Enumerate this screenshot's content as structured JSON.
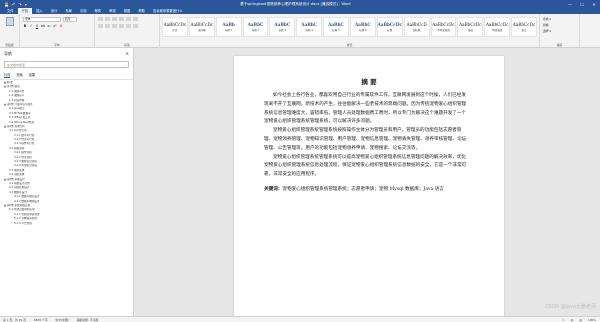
{
  "window": {
    "title": "基于springboot宠物领养心理护理系统设计.docx [兼容模式] - Word",
    "quick_access": [
      "💾",
      "↶",
      "↷",
      "▾"
    ],
    "controls": [
      "—",
      "☐",
      "✕"
    ]
  },
  "tabs": [
    "文件",
    "开始",
    "插入",
    "设计",
    "布局",
    "引用",
    "邮件",
    "审阅",
    "视图",
    "帮助",
    "告诉我你想要做什么"
  ],
  "ribbon": {
    "clipboard_label": "剪贴板",
    "font_label": "字体",
    "font_name": "宋体",
    "font_size": "四号",
    "format_buttons": [
      "B",
      "I",
      "U",
      "ab",
      "x₂",
      "x²",
      "A"
    ],
    "paragraph_label": "段落",
    "styles_label": "样式",
    "styles": [
      {
        "sample": "AaBbCcDc",
        "name": "正文",
        "head": false
      },
      {
        "sample": "AaBbCcDc",
        "name": "无间隔",
        "head": false
      },
      {
        "sample": "AaBb",
        "name": "标题 1",
        "head": true
      },
      {
        "sample": "AaBbC",
        "name": "标题 2",
        "head": true
      },
      {
        "sample": "AaBbC",
        "name": "标题 3",
        "head": true
      },
      {
        "sample": "AaBbC",
        "name": "标题 4",
        "head": true
      },
      {
        "sample": "AaBbC",
        "name": "标题 5",
        "head": true
      },
      {
        "sample": "AaBbC",
        "name": "标题 6",
        "head": true
      },
      {
        "sample": "AaBbCcDc",
        "name": "标题",
        "head": true
      },
      {
        "sample": "AaBbCcD",
        "name": "副标题",
        "head": false
      },
      {
        "sample": "AaBbCcDc",
        "name": "不明显强调",
        "head": false
      },
      {
        "sample": "AaBbCcDc",
        "name": "强调",
        "head": false
      },
      {
        "sample": "AaBbCcDc",
        "name": "明显强调",
        "head": false
      },
      {
        "sample": "AaBbCcDc",
        "name": "要点",
        "head": false
      }
    ],
    "editing_label": "编辑",
    "editing_items": [
      "查找 ▾",
      "替换",
      "选择 ▾"
    ]
  },
  "nav": {
    "title": "导航",
    "close": "✕",
    "search_placeholder": "在文档中搜索",
    "tabs": [
      "标题",
      "页面",
      "结果"
    ],
    "outline": [
      {
        "level": 1,
        "text": "▲ 摘 要"
      },
      {
        "level": 1,
        "text": "▲ 第1章 绪论"
      },
      {
        "level": 2,
        "text": "1.1 课题背景"
      },
      {
        "level": 2,
        "text": "1.2 课题意义"
      },
      {
        "level": 2,
        "text": "1.3 研究内容"
      },
      {
        "level": 1,
        "text": "▲ 第2章 开发环境与技术"
      },
      {
        "level": 2,
        "text": "2.1 Java语言"
      },
      {
        "level": 2,
        "text": "2.2 MYSQL数据库"
      },
      {
        "level": 2,
        "text": "2.3 IDEA开发工具"
      },
      {
        "level": 2,
        "text": "2.4 Spring Boot框架"
      },
      {
        "level": 1,
        "text": "▲ 第3章 需求分析"
      },
      {
        "level": 2,
        "text": "3.1 可行性分析"
      },
      {
        "level": 3,
        "text": "3.1.1 技术可行性"
      },
      {
        "level": 3,
        "text": "3.1.2 经济可行性"
      },
      {
        "level": 3,
        "text": "3.1.3 操作可行性"
      },
      {
        "level": 2,
        "text": "3.2 系统流程"
      },
      {
        "level": 3,
        "text": "3.2.1 操作流程"
      },
      {
        "level": 3,
        "text": "3.2.2 登录流程"
      },
      {
        "level": 3,
        "text": "3.2.3 删除信息流程"
      },
      {
        "level": 3,
        "text": "3.2.4 添加信息流程"
      },
      {
        "level": 2,
        "text": "3.3 性能需求"
      },
      {
        "level": 2,
        "text": "3.4 功能需求"
      },
      {
        "level": 1,
        "text": "▲ 第4章 系统设计"
      },
      {
        "level": 2,
        "text": "4.1 系统设计思想"
      },
      {
        "level": 2,
        "text": "4.2 功能结构设计"
      },
      {
        "level": 2,
        "text": "4.3 数据库设计"
      },
      {
        "level": 3,
        "text": "4.3.1 数据库概念设计"
      },
      {
        "level": 3,
        "text": "4.3.2 数据库物理设计"
      },
      {
        "level": 1,
        "text": "▲ 第5章 系统详细实现"
      },
      {
        "level": 2,
        "text": "5.1 管理员模块的实现"
      },
      {
        "level": 3,
        "text": "5.1.1 志愿者申请管理"
      },
      {
        "level": 3,
        "text": "5.1.2 宠物领养管理"
      },
      {
        "level": 3,
        "text": "5.1.3 公告管理"
      }
    ]
  },
  "document": {
    "title": "摘  要",
    "paragraphs": [
      "如今社会上各行各业，都喜欢用自己行业的专属软件工作，互联网发展到这个时候，人们已经发现离不开了互联网。新技术的产生，往往能解决一些老技术的弊端问题。因为传统宠物爱心组织管理系统信息管理难度大，容错率低，管理人员处理数据费工费时，所以专门为解决这个难题开发了一个宠物爱心组织管理系统管理系统，可以解决许多问题。",
      "宠物爱心组织管理系统管理系统按照操作主体分为管理员和用户。管理员的功能包括志愿者管理、宠物领养管理、宠物知识管理、用户管理、宠物信息管理、宠物丢失管理、领养审核管理、论坛管理、公告管理等。用户的功能包括宠物领养申请、宠物搜索、论坛交流等。",
      "宠物爱心组织管理系统管理系统可以提高宠物爱心组织管理系统信息管理问题的解决效率，优化宠物爱心组织管理系统信息处理流程，保证宠物爱心组织管理系统信息数据的安全，它是一个非常可靠，非常安全的应用程序。"
    ],
    "keywords_label": "关键词：",
    "keywords": "宠物爱心组织管理系统管理系统；志愿者申请；宠物 Mysql 数据库；Java 语言"
  },
  "status": {
    "page": "第 1 页，共 29 页",
    "words": "9839 个字",
    "language": "中文(中国)",
    "accessibility": "辅助功能: 不可用",
    "zoom": "100%"
  },
  "watermark": "CSDN @java大鹏老师"
}
